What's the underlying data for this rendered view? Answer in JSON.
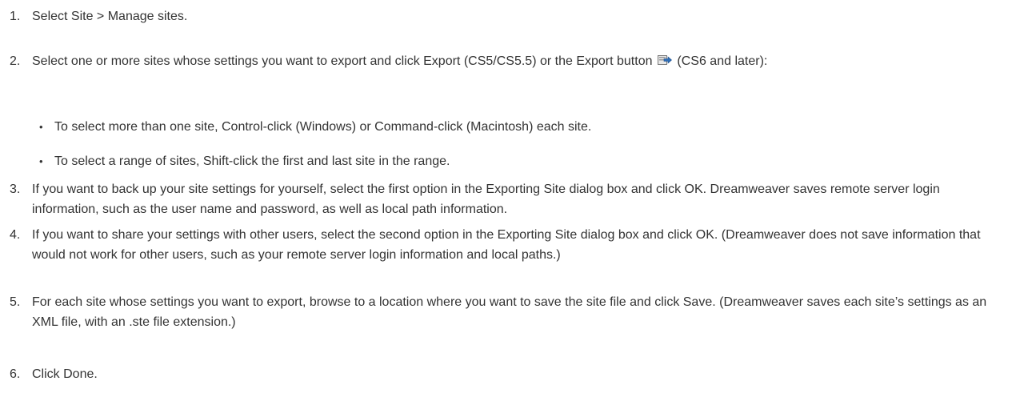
{
  "steps": [
    {
      "num": "1.",
      "text": "Select Site > Manage sites."
    },
    {
      "num": "2.",
      "text_before_icon": " Select one or more sites whose settings you want to export and click Export (CS5/CS5.5) or the Export button",
      "icon": "export-icon",
      "text_after_icon": "(CS6 and later):",
      "subitems": [
        "To select more than one site, Control-click (Windows) or Command-click (Macintosh) each site.",
        "To select a range of sites, Shift-click the first and last site in the range."
      ]
    },
    {
      "num": "3.",
      "text": "If you want to back up your site settings for yourself, select the first option in the Exporting Site dialog box and click OK. Dreamweaver saves remote server login information, such as the user name and password, as well as local path information."
    },
    {
      "num": "4.",
      "text": "If you want to share your settings with other users, select the second option in the Exporting Site dialog box and click OK. (Dreamweaver does not save information that would not work for other users, such as your remote server login information and local paths.)"
    },
    {
      "num": "5.",
      "text": "For each site whose settings you want to export, browse to a location where you want to save the site file and click Save. (Dreamweaver saves each site’s settings as an XML file, with an .ste file extension.)"
    },
    {
      "num": "6.",
      "text": "Click Done."
    }
  ],
  "bullet_glyph": "•"
}
